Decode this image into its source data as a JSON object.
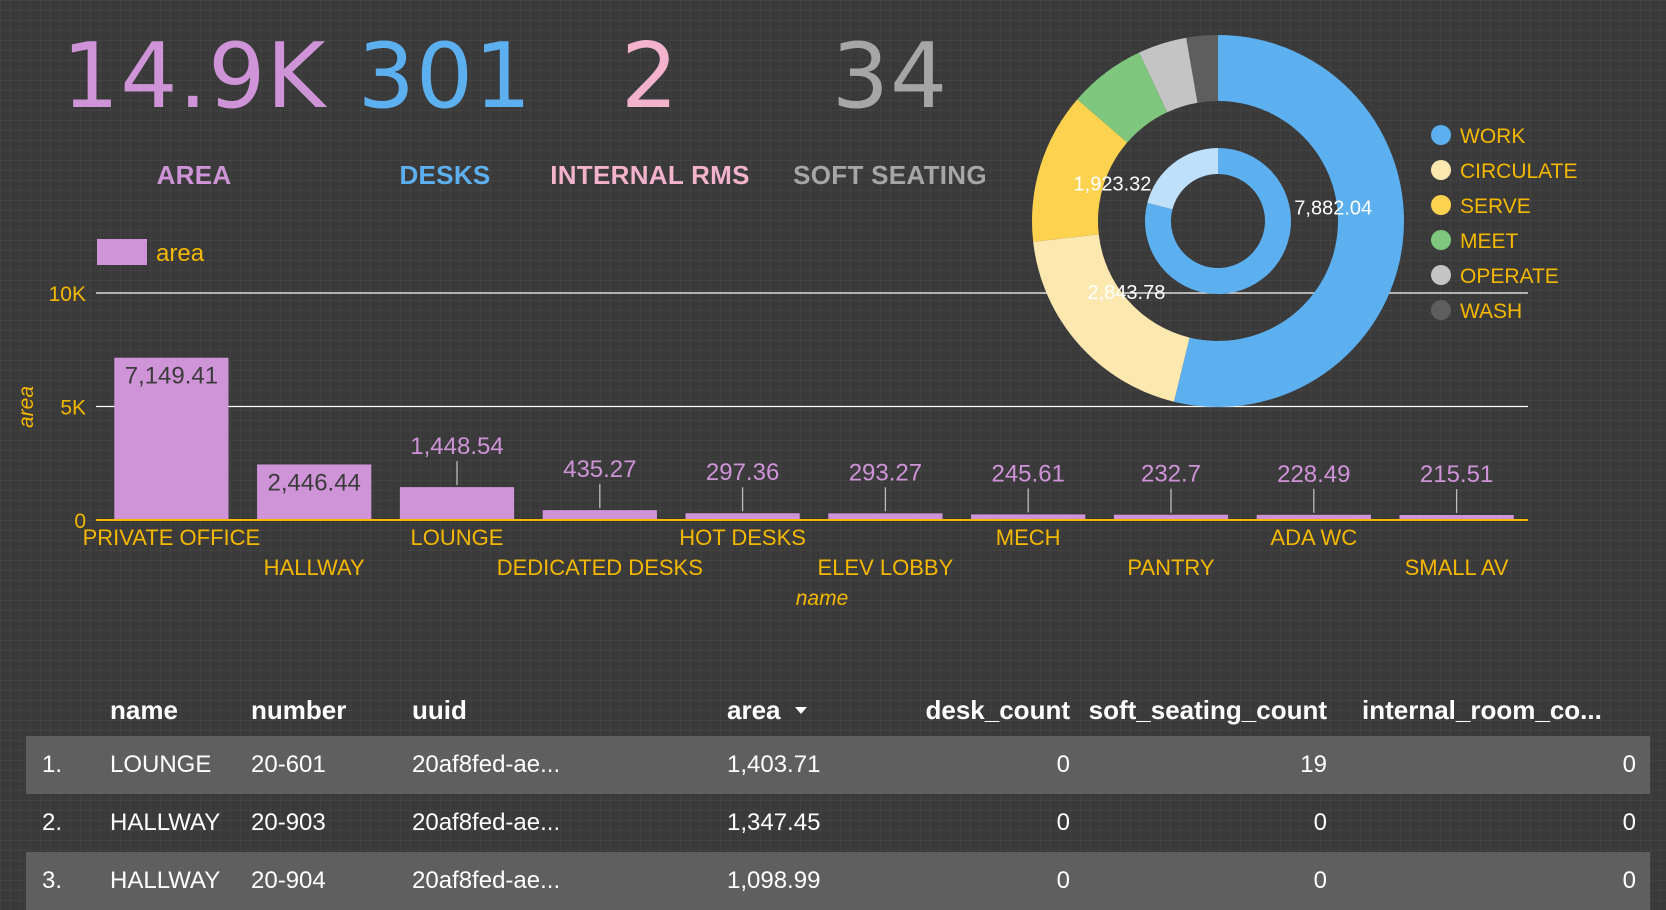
{
  "kpis": [
    {
      "value": "14.9K",
      "label": "AREA",
      "color": "#cf93d8"
    },
    {
      "value": "301",
      "label": "DESKS",
      "color": "#5db0f0"
    },
    {
      "value": "2",
      "label": "INTERNAL RMS",
      "color": "#f4b3cc"
    },
    {
      "value": "34",
      "label": "SOFT SEATING",
      "color": "#a6a6a6"
    }
  ],
  "colors": {
    "bar": "#cf93d8",
    "axis_text": "#f5b800",
    "grid": "#ffffff",
    "bar_label": "#cf93d8",
    "bar_label_inside": "#3b3b3b"
  },
  "chart_data": [
    {
      "type": "bar",
      "categories": [
        "PRIVATE OFFICE",
        "HALLWAY",
        "LOUNGE",
        "DEDICATED DESKS",
        "HOT DESKS",
        "ELEV LOBBY",
        "MECH",
        "PANTRY",
        "ADA WC",
        "SMALL AV"
      ],
      "series": [
        {
          "name": "area",
          "values": [
            7149.41,
            2446.44,
            1448.54,
            435.27,
            297.36,
            293.27,
            245.61,
            232.7,
            228.49,
            215.51
          ]
        }
      ],
      "value_labels": [
        "7,149.41",
        "2,446.44",
        "1,448.54",
        "435.27",
        "297.36",
        "293.27",
        "245.61",
        "232.7",
        "228.49",
        "215.51"
      ],
      "xlabel": "name",
      "ylabel": "area",
      "ylim": [
        0,
        10000
      ],
      "y_ticks": [
        0,
        5000,
        10000
      ],
      "y_tick_labels": [
        "0",
        "5K",
        "10K"
      ],
      "grid": true,
      "legend": "top-left"
    },
    {
      "type": "pie",
      "variant": "nested-donut",
      "legend": "right",
      "categories": [
        "WORK",
        "CIRCULATE",
        "SERVE",
        "MEET",
        "OPERATE",
        "WASH"
      ],
      "colors": [
        "#5db0f0",
        "#fde8b0",
        "#fdd24f",
        "#7fc77f",
        "#c4c4c4",
        "#5e5e5e"
      ],
      "outer_values": [
        7882.04,
        2843.78,
        1923.32,
        980,
        620,
        400
      ],
      "outer_labels": [
        "7,882.04",
        "2,843.78",
        "1,923.32",
        "",
        "",
        ""
      ],
      "inner": {
        "values": [
          0.79,
          0.21
        ],
        "colors": [
          "#5db0f0",
          "#bfe0fb"
        ]
      }
    }
  ],
  "table": {
    "columns": [
      "name",
      "number",
      "uuid",
      "area",
      "desk_count",
      "soft_seating_count",
      "internal_room_co..."
    ],
    "sort_column": "area",
    "rows": [
      {
        "index": "1.",
        "name": "LOUNGE",
        "number": "20-601",
        "uuid": "20af8fed-ae...",
        "area": "1,403.71",
        "desk_count": "0",
        "soft_seating_count": "19",
        "internal_room_count": "0"
      },
      {
        "index": "2.",
        "name": "HALLWAY",
        "number": "20-903",
        "uuid": "20af8fed-ae...",
        "area": "1,347.45",
        "desk_count": "0",
        "soft_seating_count": "0",
        "internal_room_count": "0"
      },
      {
        "index": "3.",
        "name": "HALLWAY",
        "number": "20-904",
        "uuid": "20af8fed-ae...",
        "area": "1,098.99",
        "desk_count": "0",
        "soft_seating_count": "0",
        "internal_room_count": "0"
      }
    ]
  }
}
